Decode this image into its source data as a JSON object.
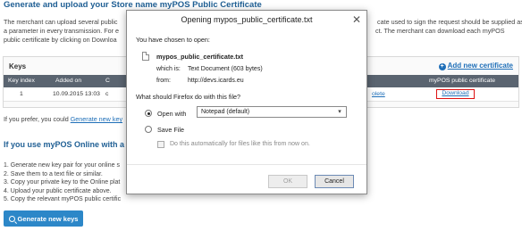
{
  "page": {
    "heading": "Generate and upload your Store name myPOS Public Certificate",
    "intro_lines_left": [
      "The merchant can upload several public",
      "a parameter in every transmission. For e",
      "public certificate by clicking on Downloa"
    ],
    "intro_lines_right": [
      "cate used to sign the request should be supplied as",
      "ct. The merchant can download each myPOS",
      ""
    ],
    "keys": {
      "title": "Keys",
      "add_new_label": "Add new certificate",
      "columns": [
        "Key index",
        "Added on",
        "C",
        "myPOS public certificate"
      ],
      "row": {
        "index": "1",
        "added_on": "10.09.2015 13:03",
        "partial_col": "c",
        "action_link": "olete",
        "download_label": "Download"
      }
    },
    "prefer_text": "If you prefer, you could ",
    "prefer_link": "Generate new key",
    "online_heading": "If you use myPOS Online with a sho",
    "steps": [
      "1. Generate new key pair for your online s",
      "2. Save them to a text file or similar.",
      "3. Copy your private key to the Online plat",
      "4. Upload your public certificate above.",
      "5. Copy the relevant myPOS public certific"
    ],
    "generate_button": "Generate new keys"
  },
  "dialog": {
    "title": "Opening mypos_public_certificate.txt",
    "chosen_label": "You have chosen to open:",
    "file_name": "mypos_public_certificate.txt",
    "which_is_label": "which is:",
    "which_is_value": "Text Document (603 bytes)",
    "from_label": "from:",
    "from_value": "http://devs.icards.eu",
    "question": "What should Firefox do with this file?",
    "open_with_label": "Open with",
    "open_with_app": "Notepad (default)",
    "save_file_label": "Save File",
    "auto_label": "Do this automatically for files like this from now on.",
    "ok_label": "OK",
    "cancel_label": "Cancel",
    "selected_option": "open_with"
  }
}
